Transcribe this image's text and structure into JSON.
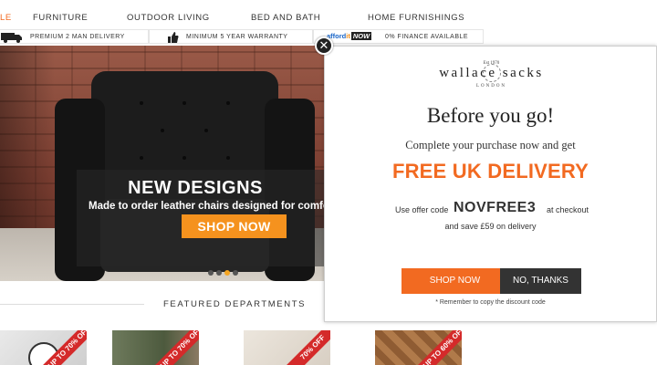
{
  "nav": {
    "partial_item": "LE",
    "items": [
      "FURNITURE",
      "OUTDOOR LIVING",
      "BED AND BATH",
      "HOME FURNISHINGS"
    ]
  },
  "usp": {
    "delivery": "PREMIUM 2 MAN DELIVERY",
    "warranty": "MINIMUM 5 YEAR WARRANTY",
    "afford_brand": "afford",
    "afford_brand_suffix": "it",
    "afford_now": "NOW",
    "finance": "0% FINANCE AVAILABLE"
  },
  "hero": {
    "headline": "NEW DESIGNS",
    "subline": "Made to order leather chairs designed for comfo",
    "cta": "SHOP NOW",
    "carousel_active_index": 2,
    "carousel_count": 4
  },
  "featured": {
    "title": "FEATURED DEPARTMENTS",
    "tiles": [
      {
        "banner": "UP TO 70% OFF"
      },
      {
        "banner": "UP TO 70% OFF"
      },
      {
        "banner": "70% OFF"
      },
      {
        "banner": "UP TO 60% OFF"
      }
    ]
  },
  "modal": {
    "close_icon": "close-icon",
    "logo": {
      "est": "Est 1970",
      "name": "wallace sacks",
      "city": "LONDON"
    },
    "title": "Before you go!",
    "subtitle": "Complete your purchase now and get",
    "headline": "FREE UK DELIVERY",
    "offer_prefix": "Use offer code",
    "offer_code": "NOVFREE3",
    "offer_suffix": "at checkout",
    "savings": "and save £59 on delivery",
    "shop_button": "SHOP NOW",
    "decline_button": "NO, THANKS",
    "reminder": "* Remember to copy the discount code"
  },
  "colors": {
    "accent_orange": "#f26a21",
    "cta_orange": "#f5921e",
    "dark_button": "#333333",
    "sale_red": "#d42a2a"
  }
}
